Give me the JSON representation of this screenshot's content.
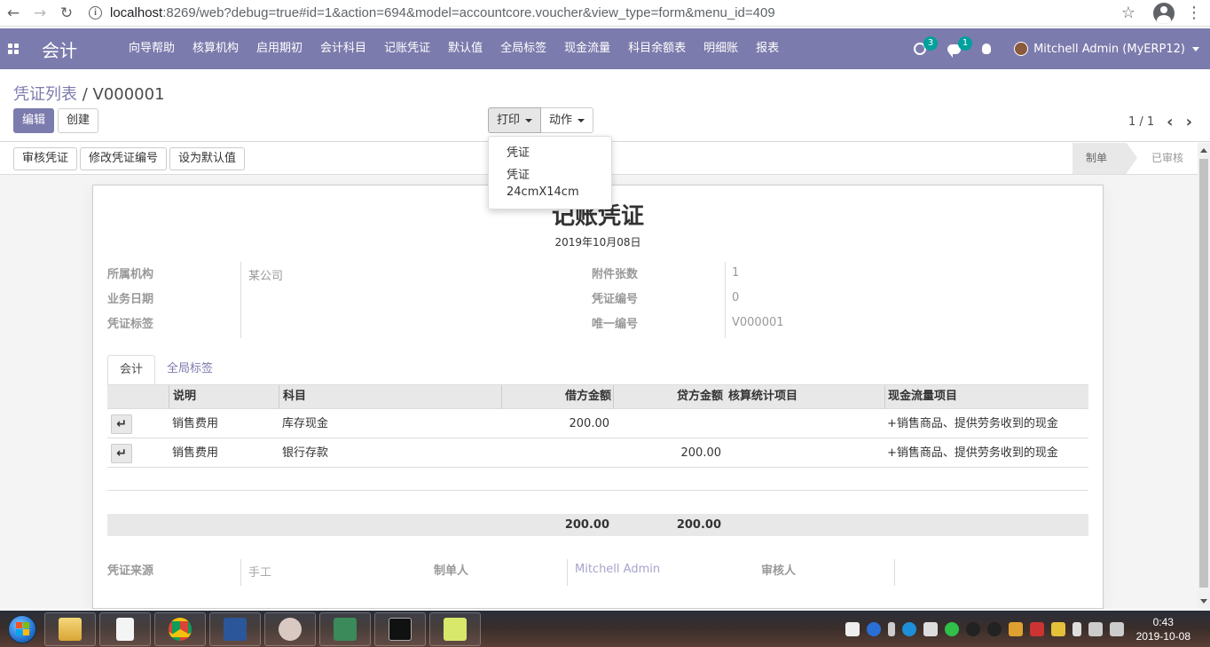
{
  "browser": {
    "url_host": "localhost",
    "url_rest": ":8269/web?debug=true#id=1&action=694&model=accountcore.voucher&view_type=form&menu_id=409"
  },
  "navbar": {
    "brand": "会计",
    "menu": [
      "向导帮助",
      "核算机构",
      "启用期初",
      "会计科目",
      "记账凭证",
      "默认值",
      "全局标签",
      "现金流量",
      "科目余额表",
      "明细账",
      "报表"
    ],
    "activity_count": "3",
    "message_count": "1",
    "user": "Mitchell Admin (MyERP12)"
  },
  "control_panel": {
    "breadcrumb_parent": "凭证列表",
    "breadcrumb_sep": " / ",
    "breadcrumb_current": "V000001",
    "edit_label": "编辑",
    "create_label": "创建",
    "print_label": "打印",
    "action_label": "动作",
    "pager": "1 / 1"
  },
  "print_menu": [
    "凭证",
    "凭证24cmX14cm"
  ],
  "statusbar": {
    "buttons": [
      "审核凭证",
      "修改凭证编号",
      "设为默认值"
    ],
    "stages": [
      "制单",
      "已审核"
    ]
  },
  "voucher": {
    "title": "记账凭证",
    "date": "2019年10月08日",
    "labels": {
      "org": "所属机构",
      "biz_date": "业务日期",
      "tag": "凭证标签",
      "attachments": "附件张数",
      "voucher_no": "凭证编号",
      "unique_no": "唯一编号",
      "source": "凭证来源",
      "maker": "制单人",
      "reviewer": "审核人"
    },
    "values": {
      "org": "某公司",
      "attachments": "1",
      "voucher_no": "0",
      "unique_no": "V000001",
      "source": "手工",
      "maker": "Mitchell Admin"
    },
    "tabs": [
      "会计",
      "全局标签"
    ],
    "columns": [
      "说明",
      "科目",
      "借方金额",
      "贷方金额",
      "核算统计项目",
      "现金流量项目"
    ],
    "rows": [
      {
        "desc": "销售费用",
        "account": "库存现金",
        "debit": "200.00",
        "credit": "",
        "stat": "",
        "cashflow": "+销售商品、提供劳务收到的现金"
      },
      {
        "desc": "销售费用",
        "account": "银行存款",
        "debit": "",
        "credit": "200.00",
        "stat": "",
        "cashflow": "+销售商品、提供劳务收到的现金"
      }
    ],
    "totals": {
      "debit": "200.00",
      "credit": "200.00"
    }
  },
  "taskbar": {
    "time": "0:43",
    "date": "2019-10-08"
  }
}
